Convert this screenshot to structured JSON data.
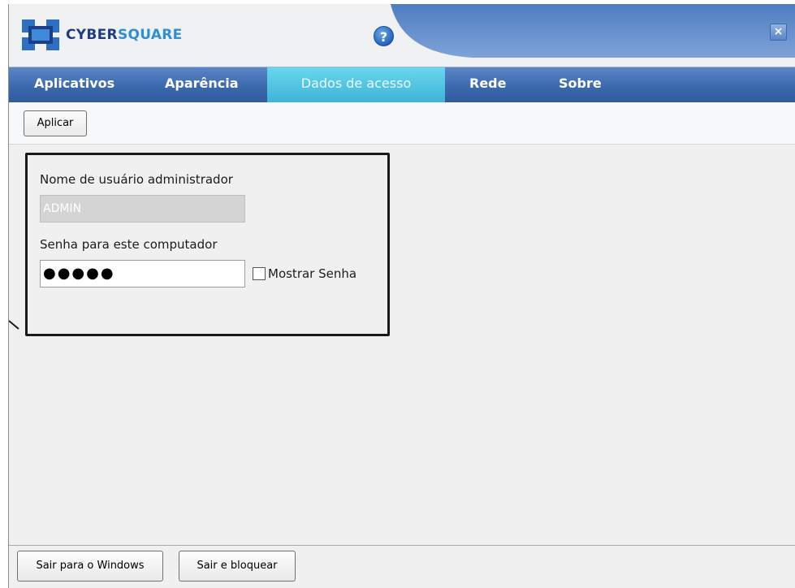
{
  "header": {
    "brand_dark": "CYBER",
    "brand_light": "SQUARE",
    "help_label": "?",
    "close_label": "×"
  },
  "tabs": [
    {
      "label": "Aplicativos",
      "active": false
    },
    {
      "label": "Aparência",
      "active": false
    },
    {
      "label": "Dados de acesso",
      "active": true
    },
    {
      "label": "Rede",
      "active": false
    },
    {
      "label": "Sobre",
      "active": false
    }
  ],
  "toolbar": {
    "apply_label": "Aplicar"
  },
  "form": {
    "username_label": "Nome de usuário administrador",
    "username_value": "ADMIN",
    "password_label": "Senha para este computador",
    "password_value": "●●●●●",
    "show_password_label": "Mostrar Senha",
    "show_password_checked": false
  },
  "footer": {
    "exit_windows_label": "Sair para o Windows",
    "exit_lock_label": "Sair e bloquear"
  },
  "colors": {
    "tabbar": "#3a66ac",
    "active_tab": "#3fb4d8",
    "brand_dark": "#1d3d82",
    "brand_light": "#2d8fd6"
  }
}
